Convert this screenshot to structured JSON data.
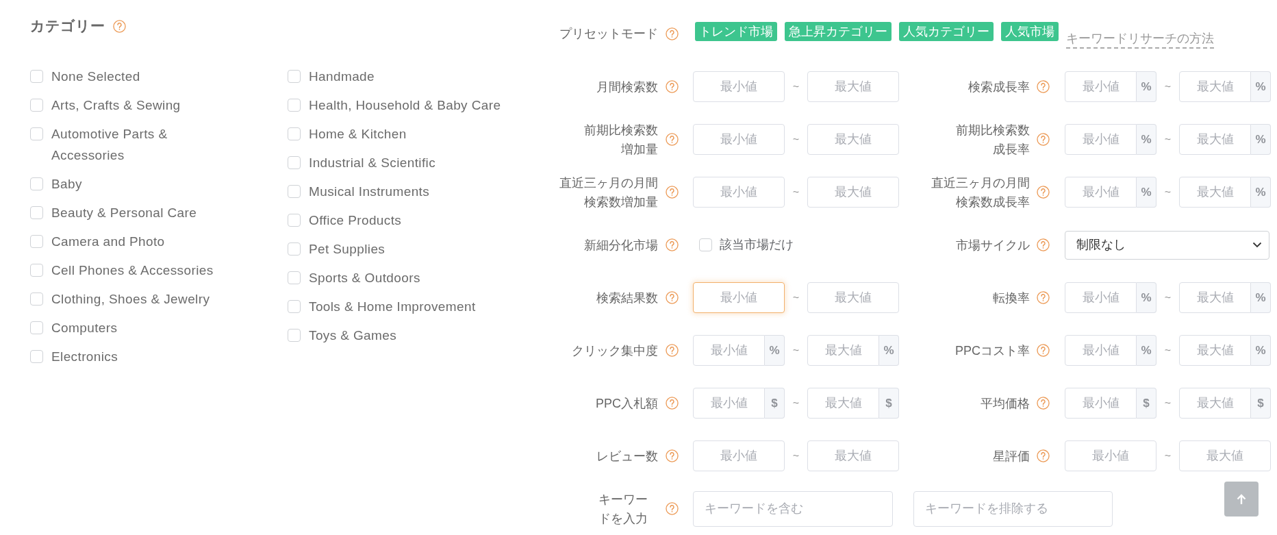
{
  "categories": {
    "title": "カテゴリー",
    "columns": [
      [
        {
          "label": "None Selected",
          "checked": false
        },
        {
          "label": "Arts, Crafts & Sewing",
          "checked": false
        },
        {
          "label": "Automotive Parts & Accessories",
          "checked": false
        },
        {
          "label": "Baby",
          "checked": false
        },
        {
          "label": "Beauty & Personal Care",
          "checked": false
        },
        {
          "label": "Camera and Photo",
          "checked": false
        },
        {
          "label": "Cell Phones & Accessories",
          "checked": false
        },
        {
          "label": "Clothing, Shoes & Jewelry",
          "checked": false
        },
        {
          "label": "Computers",
          "checked": false
        },
        {
          "label": "Electronics",
          "checked": false
        }
      ],
      [
        {
          "label": "Handmade",
          "checked": false
        },
        {
          "label": "Health, Household & Baby Care",
          "checked": false
        },
        {
          "label": "Home & Kitchen",
          "checked": false
        },
        {
          "label": "Industrial & Scientific",
          "checked": false
        },
        {
          "label": "Musical Instruments",
          "checked": false
        },
        {
          "label": "Office Products",
          "checked": false
        },
        {
          "label": "Pet Supplies",
          "checked": false
        },
        {
          "label": "Sports & Outdoors",
          "checked": false
        },
        {
          "label": "Tools & Home Improvement",
          "checked": false
        },
        {
          "label": "Toys & Games",
          "checked": false
        }
      ]
    ]
  },
  "preset_mode": {
    "label": "プリセットモード",
    "presets": [
      {
        "label": "トレンド市場"
      },
      {
        "label": "急上昇カテゴリー"
      },
      {
        "label": "人気カテゴリー"
      },
      {
        "label": "人気市場"
      }
    ],
    "guide_link": "キーワードリサーチの方法"
  },
  "filter_rows": [
    {
      "left": {
        "kind": "range",
        "label": "月間検索数",
        "min": {
          "placeholder": "最小値",
          "focused": false
        },
        "separator": "~",
        "max": {
          "placeholder": "最大値",
          "focused": false
        }
      },
      "right": {
        "kind": "range",
        "label": "検索成長率",
        "min": {
          "placeholder": "最小値",
          "unit": "%",
          "focused": false
        },
        "separator": "~",
        "max": {
          "placeholder": "最大値",
          "unit": "%",
          "focused": false
        }
      }
    },
    {
      "left": {
        "kind": "range",
        "label": "前期比検索数増加量",
        "min": {
          "placeholder": "最小値",
          "focused": false
        },
        "separator": "~",
        "max": {
          "placeholder": "最大値",
          "focused": false
        }
      },
      "right": {
        "kind": "range",
        "label": "前期比検索数成長率",
        "min": {
          "placeholder": "最小値",
          "unit": "%",
          "focused": false
        },
        "separator": "~",
        "max": {
          "placeholder": "最大値",
          "unit": "%",
          "focused": false
        }
      }
    },
    {
      "left": {
        "kind": "range",
        "label": "直近三ヶ月の月間検索数増加量",
        "min": {
          "placeholder": "最小値",
          "focused": false
        },
        "separator": "~",
        "max": {
          "placeholder": "最大値",
          "focused": false
        }
      },
      "right": {
        "kind": "range",
        "label": "直近三ヶ月の月間検索数成長率",
        "min": {
          "placeholder": "最小値",
          "unit": "%",
          "focused": false
        },
        "separator": "~",
        "max": {
          "placeholder": "最大値",
          "unit": "%",
          "focused": false
        }
      }
    },
    {
      "left": {
        "kind": "checkbox",
        "label": "新細分化市場",
        "option": {
          "label": "該当市場だけ",
          "checked": false
        }
      },
      "right": {
        "kind": "select",
        "label": "市場サイクル",
        "value": "制限なし"
      }
    },
    {
      "left": {
        "kind": "range",
        "label": "検索結果数",
        "min": {
          "placeholder": "最小値",
          "focused": true
        },
        "separator": "~",
        "max": {
          "placeholder": "最大値",
          "focused": false
        }
      },
      "right": {
        "kind": "range",
        "label": "転換率",
        "min": {
          "placeholder": "最小値",
          "unit": "%",
          "focused": false
        },
        "separator": "~",
        "max": {
          "placeholder": "最大値",
          "unit": "%",
          "focused": false
        }
      }
    },
    {
      "left": {
        "kind": "range",
        "label": "クリック集中度",
        "min": {
          "placeholder": "最小値",
          "unit": "%",
          "focused": false
        },
        "separator": "~",
        "max": {
          "placeholder": "最大値",
          "unit": "%",
          "focused": false
        }
      },
      "right": {
        "kind": "range",
        "label": "PPCコスト率",
        "min": {
          "placeholder": "最小値",
          "unit": "%",
          "focused": false
        },
        "separator": "~",
        "max": {
          "placeholder": "最大値",
          "unit": "%",
          "focused": false
        }
      }
    },
    {
      "left": {
        "kind": "range",
        "label": "PPC入札額",
        "min": {
          "placeholder": "最小値",
          "unit": "$",
          "focused": false
        },
        "separator": "~",
        "max": {
          "placeholder": "最大値",
          "unit": "$",
          "focused": false
        }
      },
      "right": {
        "kind": "range",
        "label": "平均価格",
        "min": {
          "placeholder": "最小値",
          "unit": "$",
          "focused": false
        },
        "separator": "~",
        "max": {
          "placeholder": "最大値",
          "unit": "$",
          "focused": false
        }
      }
    },
    {
      "left": {
        "kind": "range",
        "label": "レビュー数",
        "min": {
          "placeholder": "最小値",
          "focused": false
        },
        "separator": "~",
        "max": {
          "placeholder": "最大値",
          "focused": false
        }
      },
      "right": {
        "kind": "range",
        "label": "星評価",
        "min": {
          "placeholder": "最小値",
          "focused": false
        },
        "separator": "~",
        "max": {
          "placeholder": "最大値",
          "focused": false
        }
      }
    }
  ],
  "keyword_row": {
    "label": "キーワードを入力",
    "include": {
      "placeholder": "キーワードを含む"
    },
    "exclude": {
      "placeholder": "キーワードを排除する"
    }
  }
}
